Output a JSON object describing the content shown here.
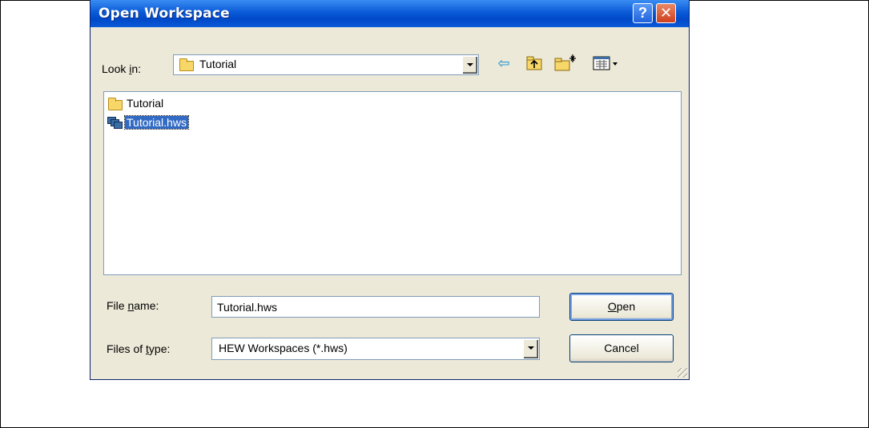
{
  "dialog": {
    "title": "Open Workspace",
    "help_button": "?",
    "close_button": "✕"
  },
  "look_in": {
    "label_prefix": "Look ",
    "label_accel": "i",
    "label_suffix": "n:",
    "value": "Tutorial"
  },
  "toolbar": {
    "back_icon": "⇦",
    "up_folder_icon": "up-one-level",
    "new_folder_icon": "create-new-folder",
    "views_icon": "view-menu"
  },
  "file_list": {
    "items": [
      {
        "label": "Tutorial",
        "type": "folder",
        "selected": false
      },
      {
        "label": "Tutorial.hws",
        "type": "workspace-file",
        "selected": true
      }
    ]
  },
  "file_name": {
    "label_prefix": "File ",
    "label_accel": "n",
    "label_suffix": "ame:",
    "value": "Tutorial.hws"
  },
  "file_type": {
    "label_prefix": "Files of ",
    "label_accel": "t",
    "label_suffix": "ype:",
    "value": "HEW Workspaces (*.hws)"
  },
  "buttons": {
    "open_accel": "O",
    "open_rest": "pen",
    "cancel": "Cancel"
  },
  "colors": {
    "titlebar": "#0a5ad8",
    "dialog_bg": "#ece9d8",
    "selection": "#316ac5"
  }
}
